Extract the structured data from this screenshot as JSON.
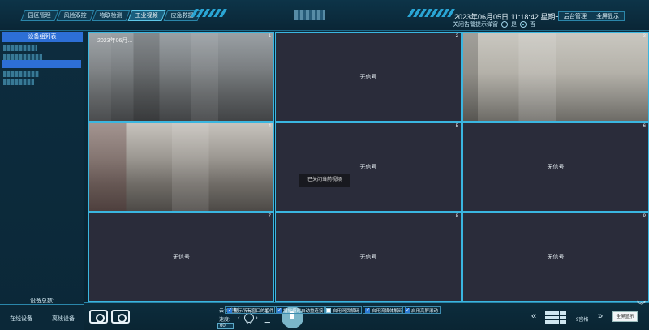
{
  "header": {
    "nav": [
      "园区管理",
      "风险双控",
      "物联检测",
      "工业视频",
      "应急救援"
    ],
    "active_nav": 3,
    "datetime": "2023年06月05日 11:18:42 星期一",
    "alarm_label": "关闭告警提示弹窗",
    "alarm_yes": "是",
    "alarm_no": "否",
    "admin_btn": "后台管理",
    "fullscreen_btn": "全屏显示"
  },
  "sidebar": {
    "title": "设备组列表",
    "total_label": "设备总数:",
    "online": "在线设备",
    "offline": "离线设备"
  },
  "grid": {
    "no_signal": "无信号",
    "cells": [
      {
        "num": "1",
        "feed": true,
        "timestamp": "2023年06月..."
      },
      {
        "num": "2",
        "feed": false
      },
      {
        "num": "3",
        "feed": true
      },
      {
        "num": "4",
        "feed": true
      },
      {
        "num": "5",
        "feed": false
      },
      {
        "num": "6",
        "feed": false
      },
      {
        "num": "7",
        "feed": false
      },
      {
        "num": "8",
        "feed": false
      },
      {
        "num": "9",
        "feed": false
      }
    ],
    "toast": "已关闭当前视频"
  },
  "toolbar": {
    "ptz_title": "云台控制",
    "speed_label": "速度:",
    "speed_value": "60",
    "checks": [
      {
        "label": "显示所有窗口的控件",
        "checked": true
      },
      {
        "label": "播放超时自动重连接",
        "checked": true
      },
      {
        "label": "启用网页解码",
        "checked": false
      },
      {
        "label": "启用流媒体解码",
        "checked": true
      },
      {
        "label": "启用高屏滚动",
        "checked": true
      }
    ],
    "layout_label": "9宫格",
    "fullscreen": "全屏显示"
  }
}
